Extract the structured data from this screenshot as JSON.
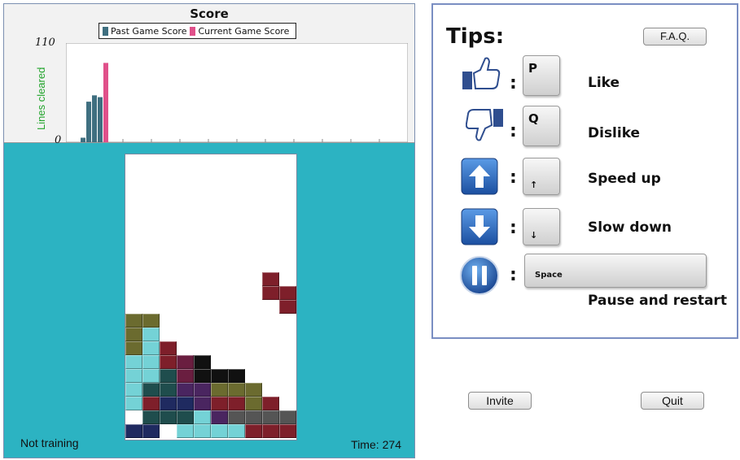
{
  "score_chart": {
    "title": "Score",
    "ylabel": "Lines cleared",
    "y_max_label": "110",
    "y_min_label": "0",
    "legend": [
      {
        "label": "Past Game Score",
        "color": "#3f6f80"
      },
      {
        "label": "Current Game Score",
        "color": "#e0508a"
      }
    ]
  },
  "chart_data": {
    "type": "bar",
    "title": "Score",
    "ylabel": "Lines cleared",
    "ylim": [
      0,
      110
    ],
    "series": [
      {
        "name": "Past Game Score",
        "values": [
          5,
          45,
          52,
          50
        ]
      },
      {
        "name": "Current Game Score",
        "values": [
          88
        ]
      }
    ],
    "grid": false,
    "legend_placement": "top-center"
  },
  "board": {
    "columns": 10,
    "rows": 20,
    "falling_piece_color": "#7e1f2a",
    "falling_piece": [
      [
        8,
        8
      ],
      [
        8,
        9
      ],
      [
        9,
        9
      ],
      [
        9,
        10
      ]
    ],
    "stack_rows": {
      "11": [
        [
          "#6b6b2f",
          0
        ],
        [
          "#6b6b2f",
          1
        ]
      ],
      "12": [
        [
          "#6b6b2f",
          0
        ],
        [
          "#74d2d6",
          1
        ]
      ],
      "13": [
        [
          "#6b6b2f",
          0
        ],
        [
          "#74d2d6",
          1
        ],
        [
          "#7e1f2a",
          2
        ]
      ],
      "14": [
        [
          "#74d2d6",
          0
        ],
        [
          "#74d2d6",
          1
        ],
        [
          "#7e1f2a",
          2
        ],
        [
          "#6a1e40",
          3
        ],
        [
          "#111111",
          4
        ]
      ],
      "15": [
        [
          "#74d2d6",
          0
        ],
        [
          "#74d2d6",
          1
        ],
        [
          "#1f4d4d",
          2
        ],
        [
          "#6a1e40",
          3
        ],
        [
          "#111111",
          4
        ],
        [
          "#111111",
          5
        ],
        [
          "#111111",
          6
        ]
      ],
      "16": [
        [
          "#74d2d6",
          0
        ],
        [
          "#1f4d4d",
          1
        ],
        [
          "#1f4d4d",
          2
        ],
        [
          "#4a2560",
          3
        ],
        [
          "#4a2560",
          4
        ],
        [
          "#6b6b2f",
          5
        ],
        [
          "#6b6b2f",
          6
        ],
        [
          "#6b6b2f",
          7
        ]
      ],
      "17": [
        [
          "#74d2d6",
          0
        ],
        [
          "#7e1f2a",
          1
        ],
        [
          "#1f2a60",
          2
        ],
        [
          "#1f2a60",
          3
        ],
        [
          "#4a2560",
          4
        ],
        [
          "#7e1f2a",
          5
        ],
        [
          "#7e1f2a",
          6
        ],
        [
          "#6b6b2f",
          7
        ],
        [
          "#7e1f2a",
          8
        ]
      ],
      "18": [
        [
          "#1f4d4d",
          1
        ],
        [
          "#1f4d4d",
          2
        ],
        [
          "#1f4d4d",
          3
        ],
        [
          "#74d2d6",
          4
        ],
        [
          "#4a2560",
          5
        ],
        [
          "#555555",
          6
        ],
        [
          "#555555",
          7
        ],
        [
          "#555555",
          8
        ],
        [
          "#555555",
          9
        ]
      ],
      "19": [
        [
          "#1f2a60",
          0
        ],
        [
          "#1f2a60",
          1
        ],
        [
          "#74d2d6",
          3
        ],
        [
          "#74d2d6",
          4
        ],
        [
          "#74d2d6",
          5
        ],
        [
          "#74d2d6",
          6
        ],
        [
          "#7e1f2a",
          7
        ],
        [
          "#7e1f2a",
          8
        ],
        [
          "#7e1f2a",
          9
        ]
      ]
    }
  },
  "status": {
    "training": "Not training",
    "time_label": "Time:",
    "time_value": "274"
  },
  "tips": {
    "title": "Tips:",
    "faq_label": "F.A.Q.",
    "items": [
      {
        "key": "P",
        "label": "Like",
        "icon": "thumbs-up-icon"
      },
      {
        "key": "Q",
        "label": "Dislike",
        "icon": "thumbs-down-icon"
      },
      {
        "key": "↑",
        "label": "Speed up",
        "icon": "arrow-up-icon"
      },
      {
        "key": "↓",
        "label": "Slow down",
        "icon": "arrow-down-icon"
      },
      {
        "key": "Space",
        "label": "Pause and restart",
        "icon": "pause-icon"
      }
    ],
    "colon": ":"
  },
  "footer": {
    "invite_label": "Invite",
    "quit_label": "Quit"
  },
  "colors": {
    "game_background": "#2cb3c2",
    "icon_blue": "#2566b8"
  }
}
